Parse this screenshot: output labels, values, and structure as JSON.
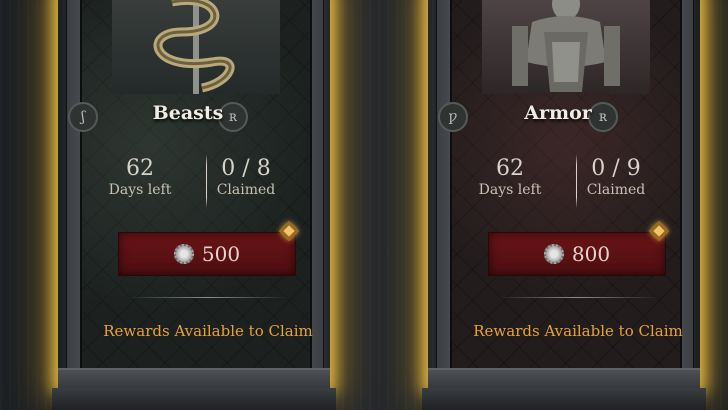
{
  "cards": [
    {
      "title": "Beasts",
      "days_left_value": "62",
      "days_left_label": "Days left",
      "claimed_value": "0 / 8",
      "claimed_label": "Claimed",
      "cost": "500",
      "status": "Rewards Available to Claim",
      "art_icon": "serpent-sword-icon"
    },
    {
      "title": "Armor",
      "days_left_value": "62",
      "days_left_label": "Days left",
      "claimed_value": "0 / 9",
      "claimed_label": "Claimed",
      "cost": "800",
      "status": "Rewards Available to Claim",
      "art_icon": "armor-knight-icon"
    }
  ],
  "colors": {
    "glow": "#f0c346",
    "cost_bg": "#5c1114",
    "status_text": "#e7a33a"
  }
}
